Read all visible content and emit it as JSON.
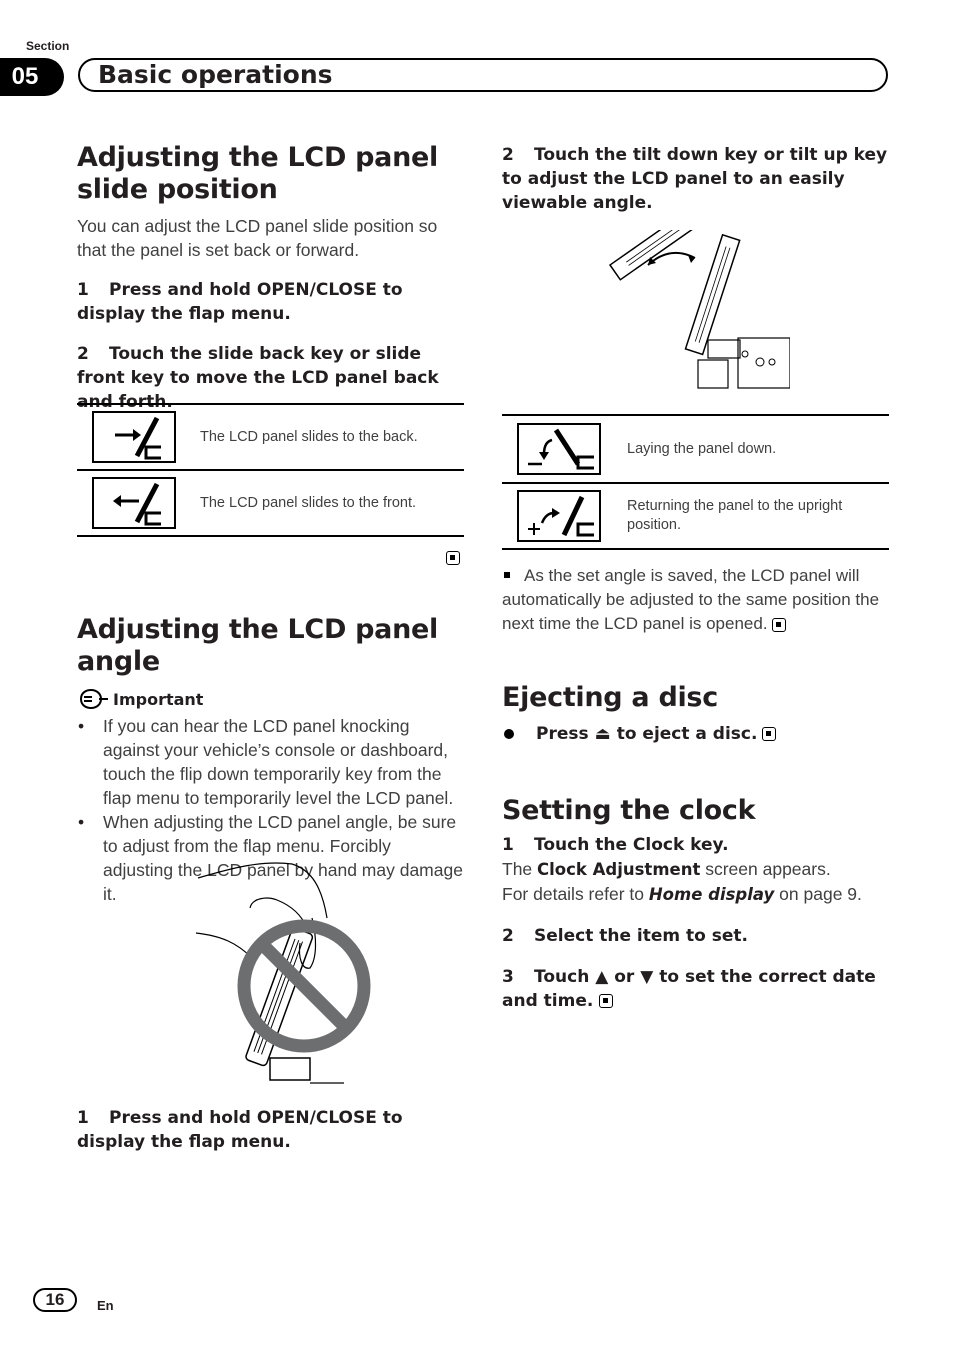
{
  "header": {
    "section_label": "Section",
    "section_number": "05",
    "section_title": "Basic operations"
  },
  "left": {
    "slide": {
      "title": "Adjusting the LCD panel slide position",
      "title_line1": "Adjusting the LCD panel",
      "title_line2": "slide position",
      "intro": "You can adjust the LCD panel slide position so that the panel is set back or forward.",
      "steps": [
        {
          "num": "1",
          "text": "Press and hold OPEN/CLOSE to display the flap menu."
        },
        {
          "num": "2",
          "text": "Touch the slide back key or slide front key to move the LCD panel back and forth."
        }
      ],
      "table": [
        {
          "icon": "slide-back-key-icon",
          "text": "The LCD panel slides to the back."
        },
        {
          "icon": "slide-front-key-icon",
          "text": "The LCD panel slides to the front."
        }
      ]
    },
    "angle": {
      "title": "Adjusting the LCD panel angle",
      "important_label": "Important",
      "bullets": [
        "If you can hear the LCD panel knocking against your vehicle’s console or dashboard, touch the flip down temporarily key from the flap menu to temporarily level the LCD panel.",
        "When adjusting the LCD panel angle, be sure to adjust from the flap menu. Forcibly adjusting the LCD panel by hand may damage it."
      ],
      "figure_alt": "Do not adjust LCD panel by hand",
      "steps": [
        {
          "num": "1",
          "text": "Press and hold OPEN/CLOSE to display the flap menu."
        }
      ]
    }
  },
  "right": {
    "angle_step2": {
      "num": "2",
      "text": "Touch the tilt down key or tilt up key to adjust the LCD panel to an easily viewable angle."
    },
    "figure_alt": "LCD panel tilting diagram",
    "table": [
      {
        "icon": "tilt-down-key-icon",
        "text": "Laying the panel down."
      },
      {
        "icon": "tilt-up-key-icon",
        "text": "Returning the panel to the upright position."
      }
    ],
    "note": "As the set angle is saved, the LCD panel will automatically be adjusted to the same position the next time the LCD panel is opened.",
    "eject": {
      "title": "Ejecting a disc",
      "step_prefix": "Press",
      "eject_symbol": "⏏",
      "step_suffix": "to eject a disc."
    },
    "clock": {
      "title": "Setting the clock",
      "step1": {
        "num": "1",
        "text": "Touch the Clock key."
      },
      "step1_body_pre": "The",
      "step1_body_bold": "Clock Adjustment",
      "step1_body_post": "screen appears.",
      "step1_ref_pre": "For details refer to",
      "step1_ref_bold": "Home display",
      "step1_ref_post": "on page 9.",
      "step2": {
        "num": "2",
        "text": "Select the item to set."
      },
      "step3_num": "3",
      "step3_pre": "Touch",
      "up_symbol": "▲",
      "step3_mid": "or",
      "down_symbol": "▼",
      "step3_post": "to set the correct date and time."
    }
  },
  "footer": {
    "page_number": "16",
    "language": "En"
  }
}
